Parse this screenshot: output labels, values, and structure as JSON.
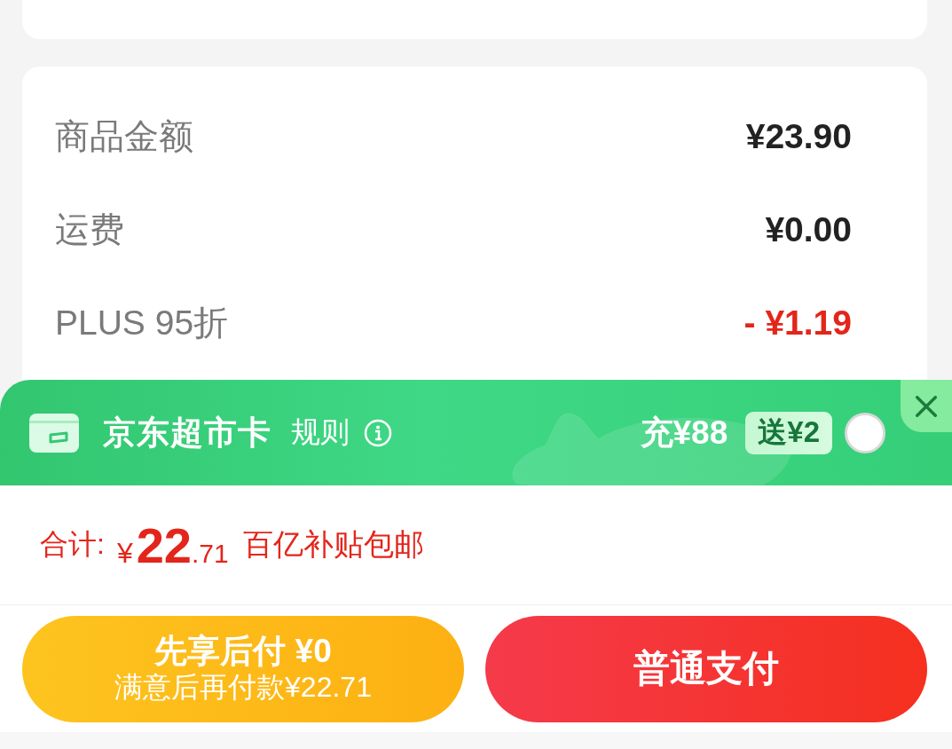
{
  "price_summary": {
    "rows": [
      {
        "label": "商品金额",
        "value": "¥23.90",
        "kind": "charge"
      },
      {
        "label": "运费",
        "value": "¥0.00",
        "kind": "charge"
      },
      {
        "label": "PLUS 95折",
        "value": "- ¥1.19",
        "kind": "discount"
      }
    ]
  },
  "promo_banner": {
    "title": "京东超市卡",
    "rules_link": "规则",
    "offer": "充¥88",
    "bonus_badge": "送¥2",
    "selected": false
  },
  "total": {
    "label": "合计:",
    "currency": "¥",
    "whole": "22",
    "fraction": ".71",
    "note": "百亿补贴包邮"
  },
  "buttons": [
    {
      "kind": "pay_later",
      "title": "先享后付 ¥0",
      "subtitle": "满意后再付款¥22.71"
    },
    {
      "kind": "pay_now",
      "title": "普通支付"
    }
  ]
}
